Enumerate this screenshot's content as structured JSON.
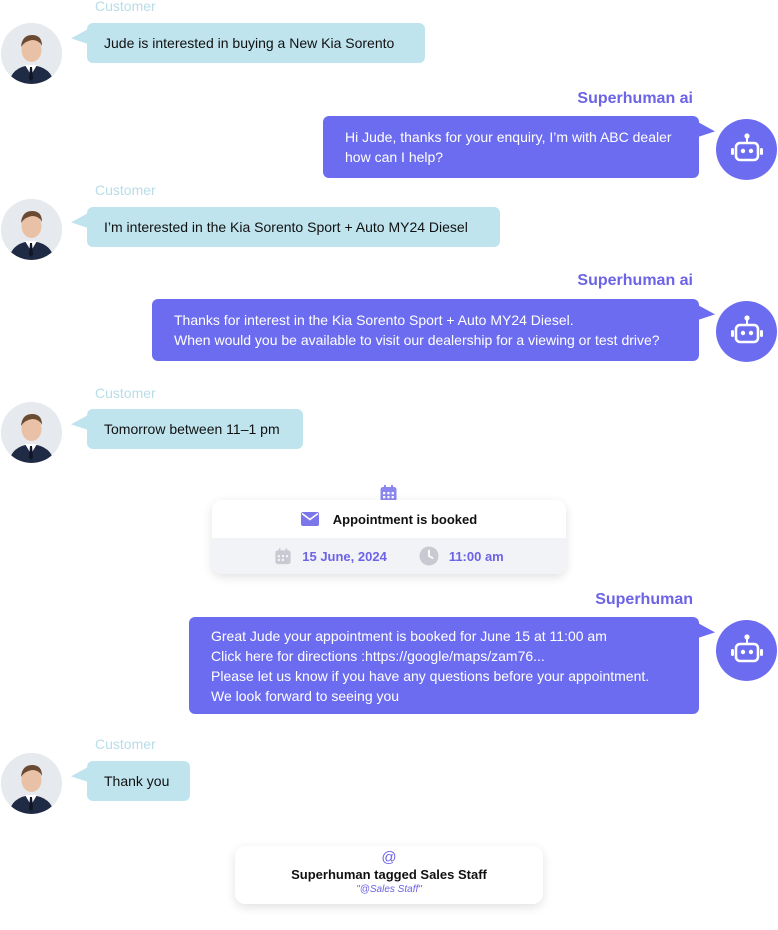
{
  "labels": {
    "customer": "Customer",
    "ai": "Superhuman ai",
    "staff": "Superhuman"
  },
  "messages": [
    {
      "from": "customer",
      "text": "Jude is interested in buying a New Kia Sorento"
    },
    {
      "from": "ai",
      "lines": [
        "Hi Jude, thanks for your enquiry, I’m with ABC dealer",
        "how can I help?"
      ]
    },
    {
      "from": "customer",
      "text": "I’m interested in the Kia Sorento Sport + Auto MY24 Diesel"
    },
    {
      "from": "ai",
      "lines": [
        "Thanks for interest in the Kia Sorento Sport + Auto MY24 Diesel.",
        "When would you be available to visit our dealership for a viewing or test drive?"
      ]
    },
    {
      "from": "customer",
      "text": "Tomorrow between 11–1 pm"
    },
    {
      "from": "staff",
      "lines": [
        "Great Jude your appointment is booked for June 15 at 11:00 am",
        "Click here for directions :https://google/maps/zam76...",
        "Please let us know if you have any questions before your appointment.",
        "We look forward to seeing you"
      ]
    },
    {
      "from": "customer",
      "text": "Thank you"
    }
  ],
  "appointment": {
    "title": "Appointment is booked",
    "date": "15 June, 2024",
    "time": "11:00 am",
    "icons": [
      "calendar-icon",
      "mail-icon",
      "clock-icon"
    ]
  },
  "tag": {
    "symbol": "@",
    "title": "Superhuman tagged Sales Staff",
    "subtitle": "\"@Sales Staff\""
  },
  "colors": {
    "customer_bubble": "#bfe4ee",
    "ai_bubble": "#6c6cf0",
    "accent": "#6c63e6",
    "customer_label": "#b9dde8"
  }
}
